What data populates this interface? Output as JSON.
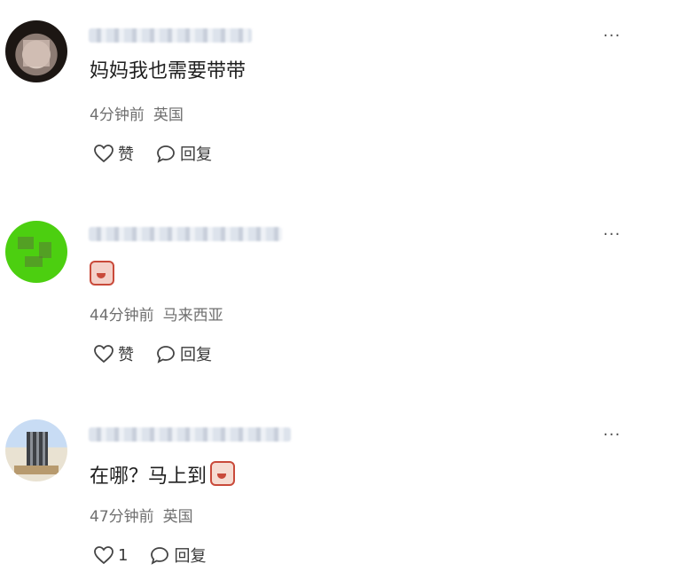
{
  "comments": [
    {
      "text": "妈妈我也需要带带",
      "time": "4分钟前",
      "location": "英国",
      "like_label": "赞",
      "reply_label": "回复",
      "more": "···"
    },
    {
      "text": "",
      "time": "44分钟前",
      "location": "马来西亚",
      "like_label": "赞",
      "reply_label": "回复",
      "more": "···"
    },
    {
      "text": "在哪？马上到",
      "time": "47分钟前",
      "location": "英国",
      "like_label": "1",
      "reply_label": "回复",
      "more": "···"
    }
  ]
}
